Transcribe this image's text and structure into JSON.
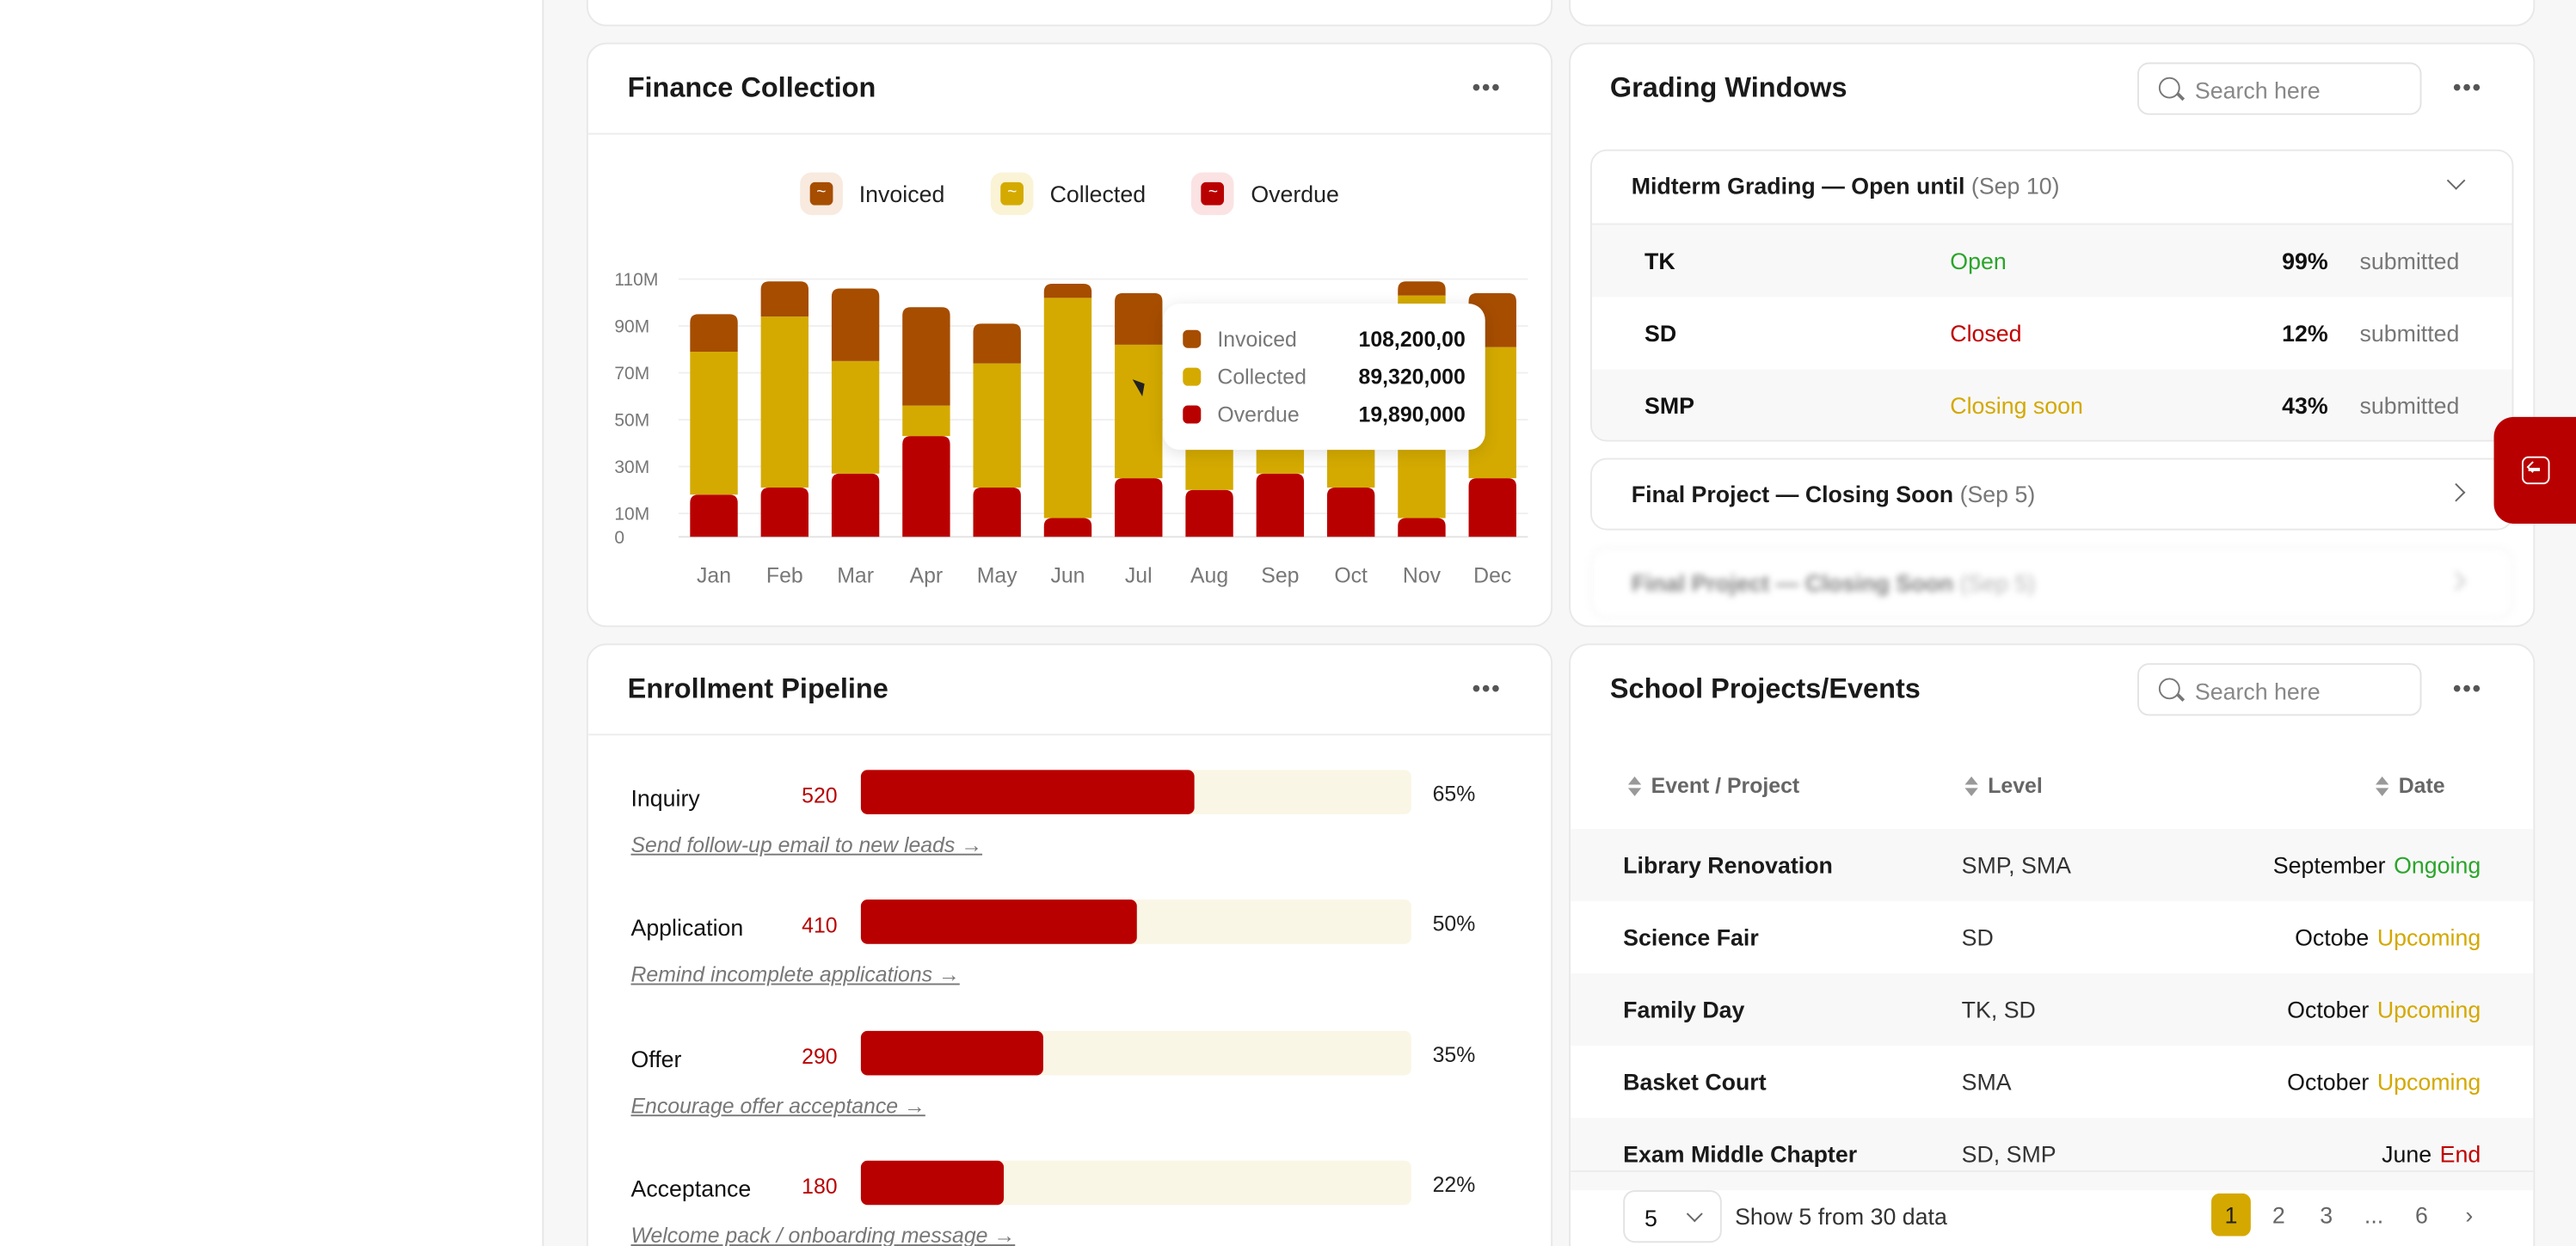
{
  "colors": {
    "invoiced": "#a64d00",
    "collected": "#d4aa00",
    "overdue": "#b90000",
    "open": "#2aa52a",
    "closed": "#c00000",
    "closing_soon": "#d4a800",
    "upcoming": "#d4a800",
    "ongoing": "#2aa52a",
    "end": "#c00000"
  },
  "finance": {
    "title": "Finance Collection",
    "legend": [
      "Invoiced",
      "Collected",
      "Overdue"
    ],
    "tooltip": {
      "rows": [
        {
          "name": "Invoiced",
          "value": "108,200,00"
        },
        {
          "name": "Collected",
          "value": "89,320,000"
        },
        {
          "name": "Overdue",
          "value": "19,890,000"
        }
      ]
    }
  },
  "chart_data": {
    "type": "bar",
    "stacked": true,
    "categories": [
      "Jan",
      "Feb",
      "Mar",
      "Apr",
      "May",
      "Jun",
      "Jul",
      "Aug",
      "Sep",
      "Oct",
      "Nov",
      "Dec"
    ],
    "y_ticks": [
      "0",
      "10M",
      "30M",
      "50M",
      "70M",
      "90M",
      "110M"
    ],
    "series": [
      {
        "name": "Overdue",
        "values": [
          18,
          21,
          27,
          43,
          21,
          8,
          25,
          20,
          27,
          21,
          8,
          25
        ]
      },
      {
        "name": "Collected",
        "values": [
          61,
          73,
          48,
          13,
          53,
          94,
          57,
          45,
          30,
          50,
          95,
          56
        ]
      },
      {
        "name": "Invoiced",
        "values": [
          16,
          15,
          31,
          42,
          17,
          6,
          22,
          25,
          23,
          20,
          6,
          23
        ]
      }
    ],
    "ylim": [
      0,
      110
    ],
    "grid": true,
    "legend_position": "top-center"
  },
  "grading": {
    "title": "Grading Windows",
    "search_placeholder": "Search here",
    "windows": [
      {
        "title": "Midterm Grading — Open until",
        "date": "(Sep 10)",
        "rows": [
          {
            "level": "TK",
            "status": "Open",
            "pct": "99%",
            "suffix": "submitted"
          },
          {
            "level": "SD",
            "status": "Closed",
            "pct": "12%",
            "suffix": "submitted"
          },
          {
            "level": "SMP",
            "status": "Closing soon",
            "pct": "43%",
            "suffix": "submitted"
          }
        ]
      },
      {
        "title": "Final Project — Closing Soon",
        "date": "(Sep 5)"
      },
      {
        "title": "Final Project — Closing Soon",
        "date": "(Sep 5)"
      }
    ]
  },
  "enrollment": {
    "title": "Enrollment Pipeline",
    "stages": [
      {
        "name": "Inquiry",
        "count": "520",
        "pct": "65%",
        "fill": 0.605,
        "action": "Send follow-up email to new leads →"
      },
      {
        "name": "Application",
        "count": "410",
        "pct": "50%",
        "fill": 0.5,
        "action": "Remind incomplete applications →"
      },
      {
        "name": "Offer",
        "count": "290",
        "pct": "35%",
        "fill": 0.33,
        "action": "Encourage offer acceptance →"
      },
      {
        "name": "Acceptance",
        "count": "180",
        "pct": "22%",
        "fill": 0.26,
        "action": "Welcome pack / onboarding message →"
      }
    ]
  },
  "projects": {
    "title": "School Projects/Events",
    "search_placeholder": "Search here",
    "columns": [
      "Event / Project",
      "Level",
      "Date"
    ],
    "rows": [
      {
        "event": "Library Renovation",
        "level": "SMP, SMA",
        "date": "September",
        "status": "Ongoing"
      },
      {
        "event": "Science Fair",
        "level": "SD",
        "date": "Octobe",
        "status": "Upcoming"
      },
      {
        "event": "Family Day",
        "level": "TK, SD",
        "date": "October",
        "status": "Upcoming"
      },
      {
        "event": "Basket Court",
        "level": "SMA",
        "date": "October",
        "status": "Upcoming"
      },
      {
        "event": "Exam Middle Chapter",
        "level": "SD, SMP",
        "date": "June",
        "status": "End"
      }
    ],
    "page_size": "5",
    "page_info": "Show 5 from 30 data",
    "pages": [
      "1",
      "2",
      "3",
      "...",
      "6"
    ]
  }
}
